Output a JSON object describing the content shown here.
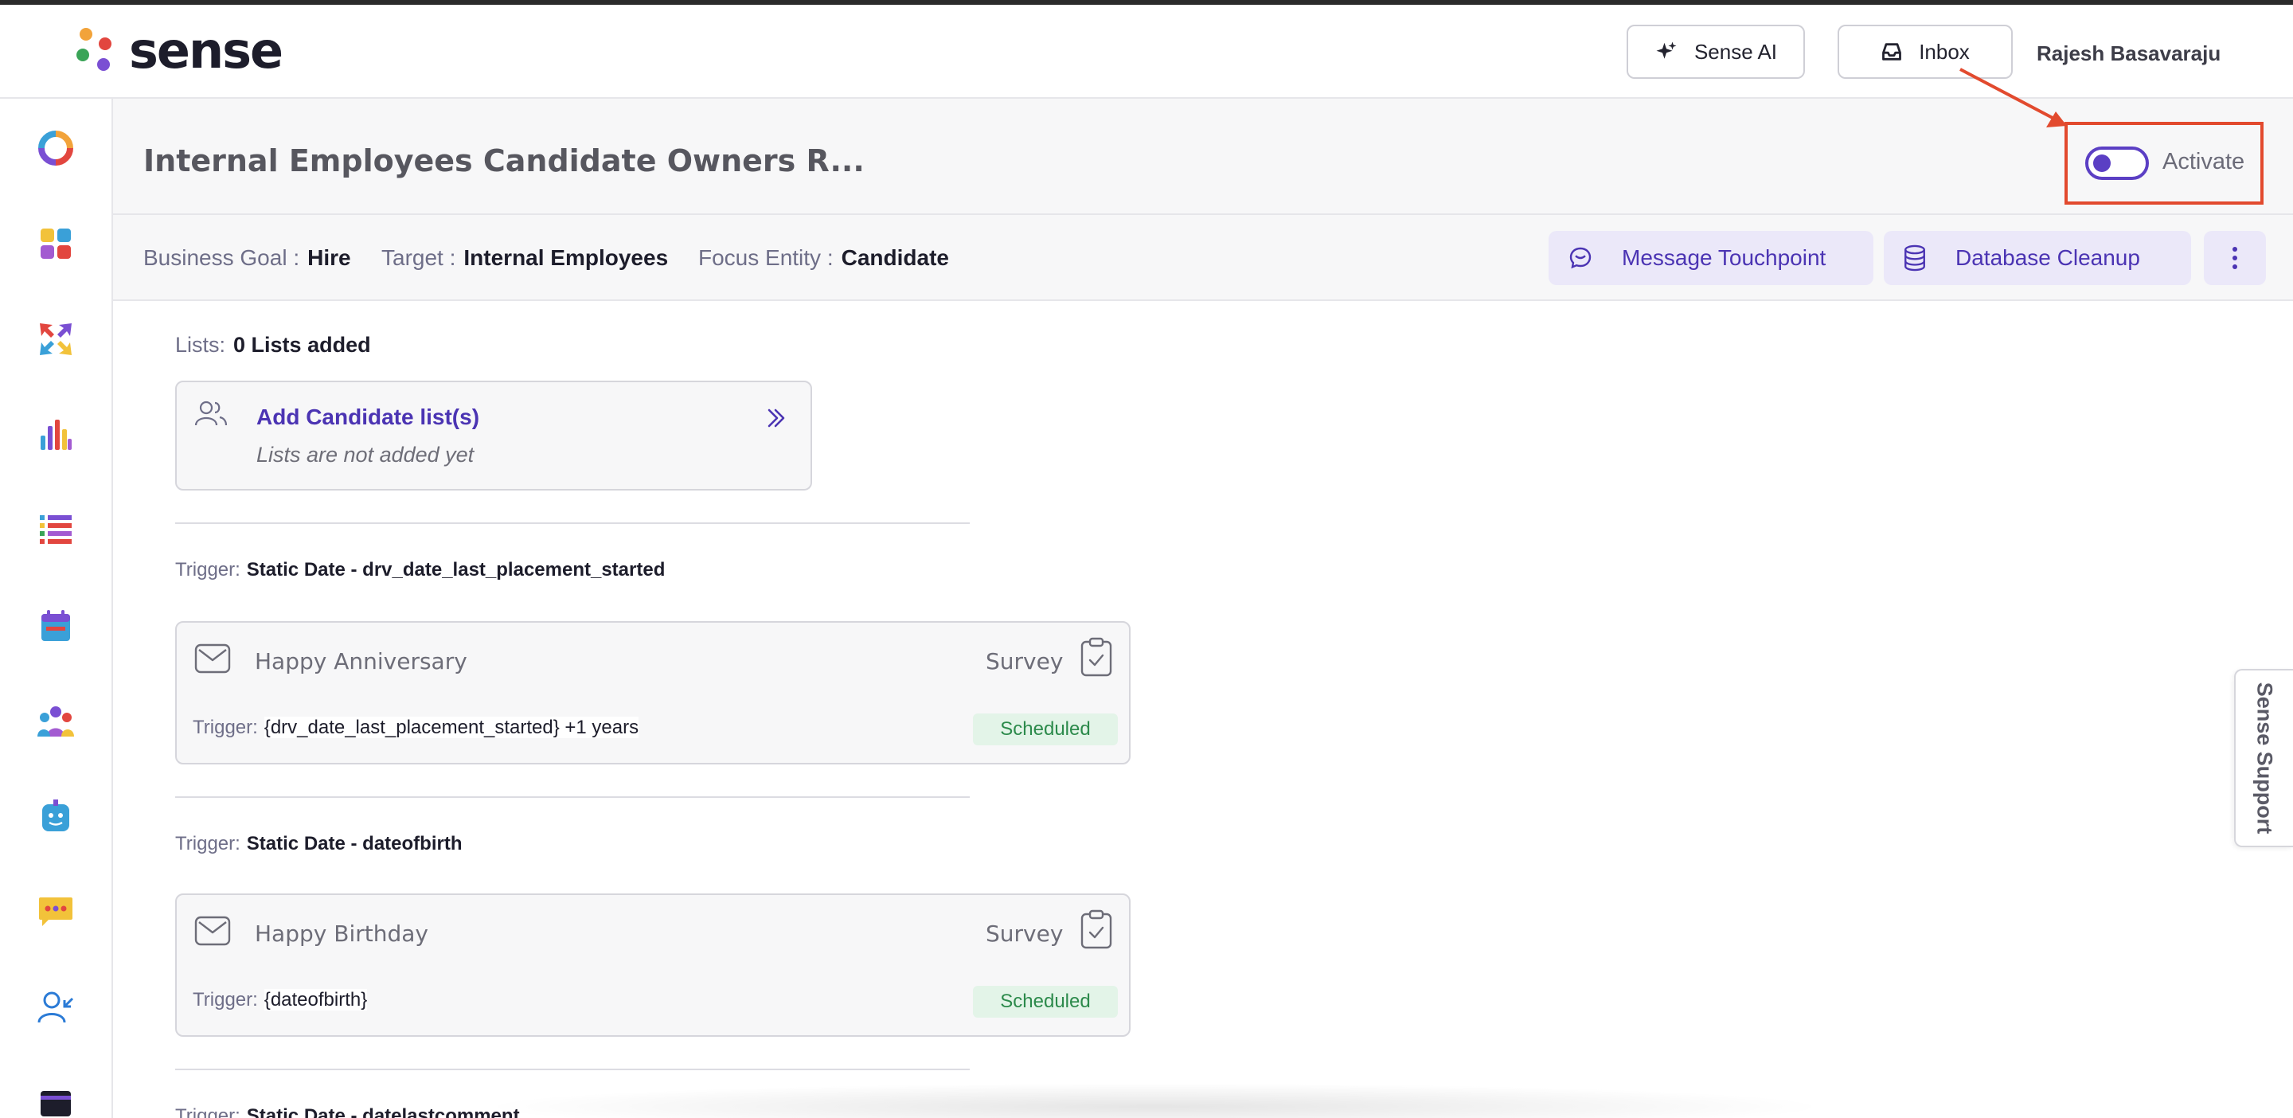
{
  "app": {
    "brand": "sense",
    "brand_colors": [
      "#f2a33a",
      "#e2463f",
      "#3aa457",
      "#7a4fd3"
    ]
  },
  "header": {
    "sense_ai_label": "Sense AI",
    "inbox_label": "Inbox",
    "user_name": "Rajesh Basavaraju"
  },
  "sidebar": {
    "items": [
      {
        "icon": "donut-chart-icon"
      },
      {
        "icon": "apps-grid-icon"
      },
      {
        "icon": "arrows-cross-icon"
      },
      {
        "icon": "bar-chart-icon"
      },
      {
        "icon": "list-stack-icon"
      },
      {
        "icon": "calendar-icon"
      },
      {
        "icon": "users-group-icon"
      },
      {
        "icon": "bot-icon"
      },
      {
        "icon": "chat-bubble-icon"
      },
      {
        "icon": "user-arrow-icon"
      },
      {
        "icon": "wallet-icon"
      }
    ]
  },
  "workflow": {
    "title": "Internal Employees Candidate Owners R...",
    "activate_label": "Activate",
    "activated": false,
    "business_goal_key": "Business Goal :",
    "business_goal": "Hire",
    "target_key": "Target :",
    "target": "Internal Employees",
    "focus_entity_key": "Focus Entity :",
    "focus_entity": "Candidate",
    "message_touchpoint_label": "Message Touchpoint",
    "database_cleanup_label": "Database Cleanup"
  },
  "lists": {
    "key": "Lists:",
    "value": "0 Lists added",
    "add_title": "Add Candidate list(s)",
    "add_subtitle": "Lists are not added yet"
  },
  "triggers": [
    {
      "key": "Trigger:",
      "value": "Static Date - drv_date_last_placement_started",
      "touchpoint": {
        "name": "Happy Anniversary",
        "type": "Survey",
        "trigger_key": "Trigger:",
        "trigger_value": "{drv_date_last_placement_started} +1 years",
        "status": "Scheduled"
      }
    },
    {
      "key": "Trigger:",
      "value": "Static Date - dateofbirth",
      "touchpoint": {
        "name": "Happy Birthday",
        "type": "Survey",
        "trigger_key": "Trigger:",
        "trigger_value": "{dateofbirth}",
        "status": "Scheduled"
      }
    },
    {
      "key": "Trigger:",
      "value": "Static Date - datelastcomment"
    }
  ],
  "support_tab_label": "Sense Support",
  "colors": {
    "accent": "#5b3fc4",
    "annotation": "#e24a2e",
    "scheduled_bg": "#e3f4e8",
    "scheduled_text": "#2c8a4b"
  }
}
